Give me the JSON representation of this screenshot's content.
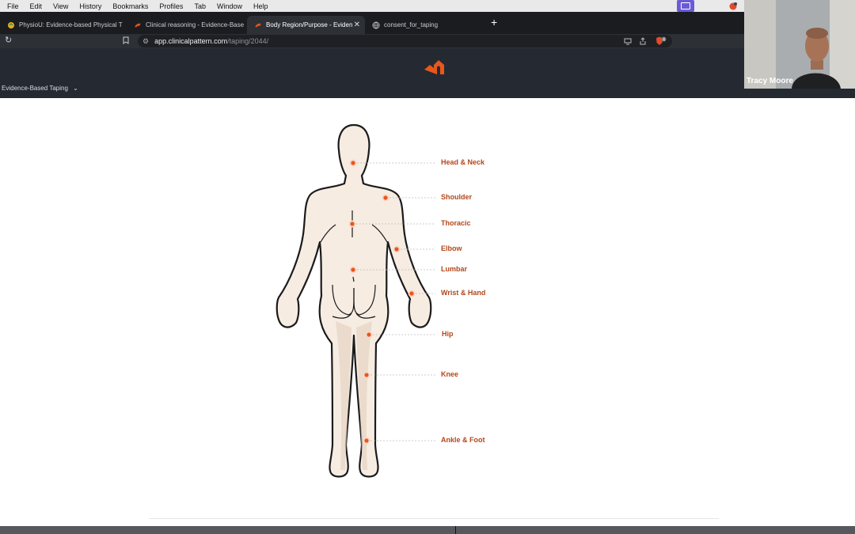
{
  "menubar": {
    "items": [
      "File",
      "Edit",
      "View",
      "History",
      "Bookmarks",
      "Profiles",
      "Tab",
      "Window",
      "Help"
    ]
  },
  "tabs": [
    {
      "label": "PhysioU: Evidence-based Physical T",
      "active": false
    },
    {
      "label": "Clinical reasoning - Evidence-Base",
      "active": false
    },
    {
      "label": "Body Region/Purpose - Eviden",
      "active": true
    },
    {
      "label": "consent_for_taping",
      "active": false
    }
  ],
  "address": {
    "host": "app.clinicalpattern.com",
    "path": "/taping/2044/",
    "extension_badge": "4"
  },
  "app": {
    "nav_label": "Evidence-Based Taping"
  },
  "video": {
    "participant_name": "Tracy Moore"
  },
  "body_regions": [
    {
      "label": "Head & Neck"
    },
    {
      "label": "Shoulder"
    },
    {
      "label": "Thoracic"
    },
    {
      "label": "Elbow"
    },
    {
      "label": "Lumbar"
    },
    {
      "label": "Wrist & Hand"
    },
    {
      "label": "Hip"
    },
    {
      "label": "Knee"
    },
    {
      "label": "Ankle & Foot"
    }
  ],
  "colors": {
    "accent": "#e8571c",
    "label": "#b3471c",
    "header_bg": "#252a32"
  }
}
